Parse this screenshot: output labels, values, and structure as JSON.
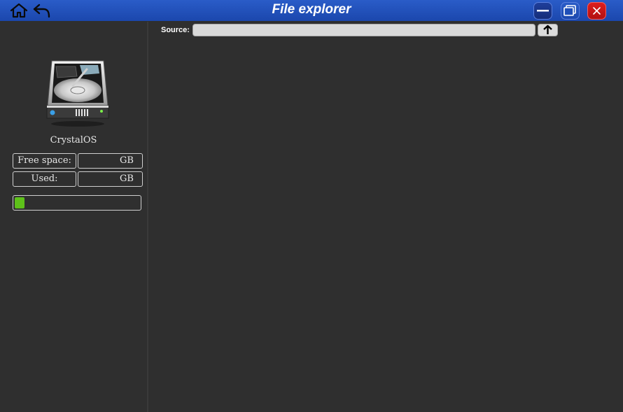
{
  "window": {
    "title": "File explorer",
    "accent": "#1b47ad",
    "close_color": "#d01616"
  },
  "toolbar": {
    "home_icon": "home-icon",
    "back_icon": "back-arrow-icon",
    "min_icon": "minimize-icon",
    "max_icon": "maximize-icon",
    "close_icon": "close-icon"
  },
  "sidebar": {
    "drive_icon": "hard-drive-icon",
    "drive_name": "CrystalOS",
    "free_label": "Free space:",
    "free_value": "GB",
    "used_label": "Used:",
    "used_value": "GB",
    "usage_fraction": 0.08,
    "usage_color": "#5ec11a"
  },
  "main": {
    "source_label": "Source:",
    "source_value": "",
    "up_icon": "up-arrow-icon"
  }
}
